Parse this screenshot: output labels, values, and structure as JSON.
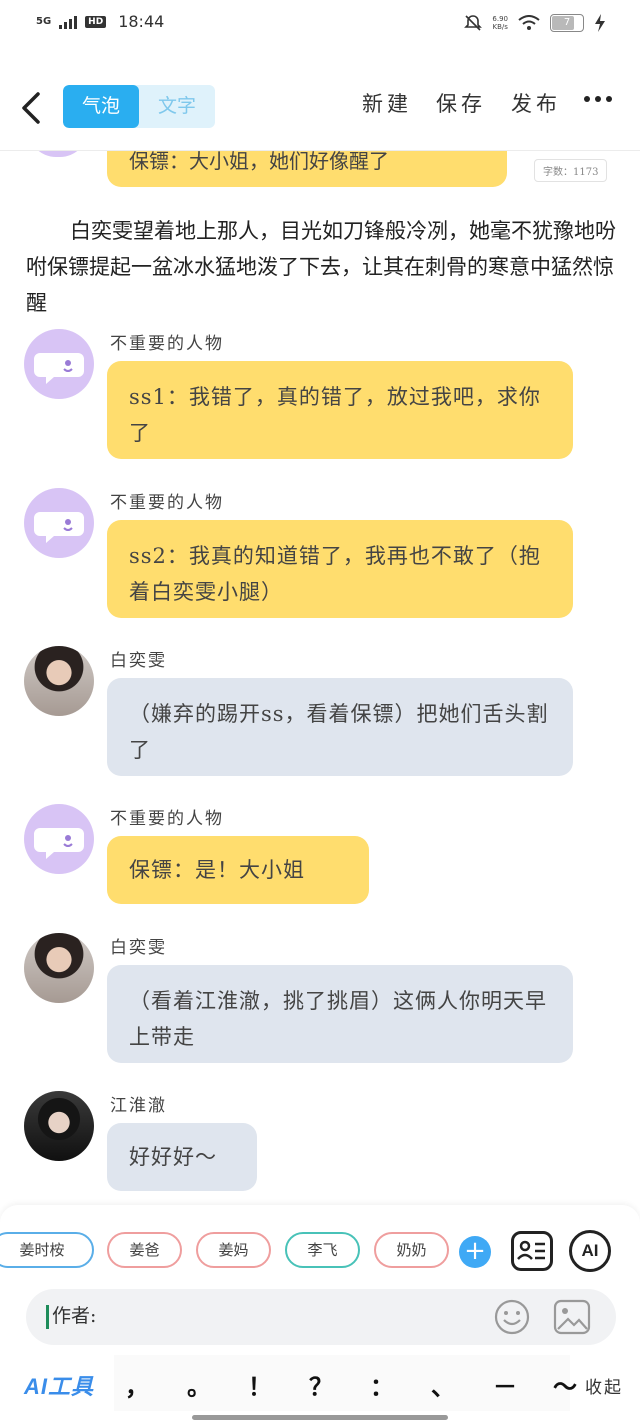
{
  "status_bar": {
    "network": "5G",
    "hd": "HD",
    "time": "18:44",
    "speed_value": "6.90",
    "speed_unit": "KB/s",
    "battery": "7"
  },
  "header": {
    "toggle": {
      "bubble": "气泡",
      "text": "文字"
    },
    "new_label": "新建",
    "save_label": "保存",
    "publish_label": "发布"
  },
  "chat": {
    "partial_top_text": "保镖：大小姐，她们好像醒了",
    "word_count": "字数：1173",
    "narration": "白奕雯望着地上那人，目光如刀锋般冷冽，她毫不犹豫地吩咐保镖提起一盆冰水猛地泼了下去，让其在刺骨的寒意中猛然惊醒",
    "messages": [
      {
        "name": "不重要的人物",
        "text": "ss1：我错了，真的错了，放过我吧，求你了",
        "style": "yellow",
        "avatar": "purple"
      },
      {
        "name": "不重要的人物",
        "text": "ss2：我真的知道错了，我再也不敢了（抱着白奕雯小腿）",
        "style": "yellow",
        "avatar": "purple"
      },
      {
        "name": "白奕雯",
        "text": "（嫌弃的踢开ss，看着保镖）把她们舌头割了",
        "style": "grey",
        "avatar": "photo1"
      },
      {
        "name": "不重要的人物",
        "text": "保镖：是！大小姐",
        "style": "yellow",
        "avatar": "purple"
      },
      {
        "name": "白奕雯",
        "text": "（看着江淮澈，挑了挑眉）这俩人你明天早上带走",
        "style": "grey",
        "avatar": "photo1"
      },
      {
        "name": "江淮澈",
        "text": "好好好～",
        "style": "grey",
        "avatar": "photo2"
      }
    ]
  },
  "bottom": {
    "chips": [
      "姜时桉",
      "姜爸",
      "姜妈",
      "李飞",
      "奶奶"
    ],
    "add_label": "+",
    "ai_label": "AI",
    "input_value": "作者:",
    "ai_tools_label": "AI工具",
    "punctuation": [
      "，",
      "。",
      "！",
      "？",
      "：",
      "、",
      "－",
      "～"
    ],
    "collapse_label": "收起"
  },
  "colors": {
    "accent": "#2aaef0",
    "bubble_yellow": "#ffdd6e",
    "bubble_grey": "#dfe5ee",
    "avatar_purple": "#d8c4f5"
  }
}
